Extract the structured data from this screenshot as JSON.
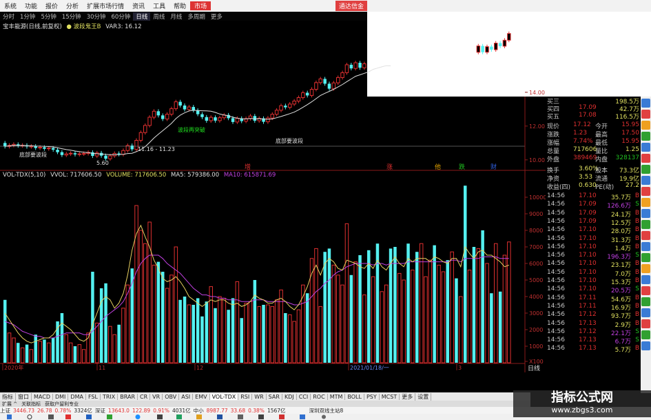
{
  "menu": {
    "items": [
      "系统",
      "功能",
      "报价",
      "分析",
      "扩展市场行情",
      "资讯",
      "工具",
      "帮助",
      "市场"
    ],
    "active_index": 8,
    "download_label": "通达信金"
  },
  "periods": [
    "分时",
    "1分钟",
    "5分钟",
    "15分钟",
    "30分钟",
    "60分钟",
    "日线",
    "周线",
    "月线",
    "多周期",
    "更多"
  ],
  "period_selected": 6,
  "title_line": {
    "stock": "宝丰能源(日线,前复权)",
    "indicator": "● 波段鬼王B",
    "var": "VAR3: 16.12"
  },
  "price_labels": {
    "low_tag": "5.60",
    "range_tag": "11.16 - 11.23",
    "buy1": "底部要波段",
    "buy2": "波段再突破",
    "buy3": "底部要波段"
  },
  "price_axis": [
    "14.00",
    "12.00",
    "10.00"
  ],
  "event_tags": [
    {
      "text": "增",
      "color": "#e03030"
    },
    {
      "text": "涨",
      "color": "#e03030"
    },
    {
      "text": "他",
      "color": "#e0a000"
    },
    {
      "text": "跌",
      "color": "#20c020"
    },
    {
      "text": "财",
      "color": "#3060e0"
    }
  ],
  "vol_line": {
    "name": "VOL-TDX(5,10)",
    "vvol": "VVOL: 717606.50",
    "volume": "VOLUME: 717606.50",
    "ma5": "MA5: 579386.00",
    "ma10": "MA10: 615871.69"
  },
  "vol_axis": [
    "10000",
    "9000",
    "8000",
    "7000",
    "6000",
    "5000",
    "4000",
    "3000",
    "2000",
    "1000",
    "X100"
  ],
  "x_labels": [
    "2020年",
    "11",
    "12",
    "2021/01/18/一",
    "3"
  ],
  "x_right_label": "日线",
  "colors": {
    "up": "#e03030",
    "down": "#54f0f0",
    "ma5": "#e8d060",
    "ma10": "#c040e0",
    "ma_price": "#e0e0e0"
  },
  "chart_data": {
    "type": "bar",
    "title": "",
    "xlabel": "",
    "ylabel": "",
    "ylim": [
      0,
      11000
    ],
    "series": [
      {
        "name": "VOLUME",
        "values": [
          3800,
          1800,
          1500,
          1200,
          900,
          1100,
          800,
          1700,
          1300,
          1400,
          1200,
          1500,
          2500,
          3000,
          1700,
          1200,
          1000,
          1100,
          800,
          1800,
          5500,
          2400,
          4500,
          4800,
          2200,
          1700,
          2300,
          3300,
          4700,
          5700,
          9500,
          8000,
          7200,
          8500,
          5900,
          6100,
          5500,
          4500,
          5300,
          7000,
          3800,
          4000,
          3500,
          3500,
          3900,
          2800,
          3700,
          4600,
          3300,
          4000,
          3900,
          3200,
          3900,
          4900,
          2700,
          3600,
          3700,
          5000,
          3400,
          3500,
          3500,
          3400,
          3800,
          4400,
          3000,
          2900,
          2500,
          3200,
          4700,
          4200,
          6300,
          6900,
          3400,
          6700,
          6900,
          5900,
          5300,
          4700,
          8400,
          5300,
          6100,
          6500,
          4100,
          6800,
          5200,
          7200,
          4300,
          4700,
          6900,
          7000,
          5400,
          5000,
          7200,
          5600,
          6700,
          7200,
          5200,
          6200,
          7100,
          5900,
          5500,
          6200,
          6700,
          5100,
          4000,
          10700,
          5600,
          7000,
          6900,
          8000,
          6000,
          4200,
          7200,
          4300,
          6500,
          7300
        ]
      }
    ],
    "up_flags": [
      0,
      1,
      1,
      0,
      1,
      0,
      1,
      0,
      1,
      0,
      1,
      0,
      0,
      0,
      1,
      1,
      0,
      1,
      1,
      1,
      0,
      1,
      0,
      0,
      1,
      1,
      0,
      1,
      1,
      0,
      1,
      1,
      1,
      1,
      1,
      0,
      0,
      1,
      1,
      1,
      0,
      0,
      1,
      0,
      0,
      0,
      0,
      1,
      0,
      1,
      1,
      0,
      0,
      1,
      0,
      1,
      1,
      0,
      1,
      0,
      1,
      1,
      1,
      1,
      0,
      1,
      1,
      1,
      1,
      0,
      1,
      1,
      1,
      0,
      0,
      1,
      1,
      1,
      1,
      0,
      1,
      0,
      1,
      0,
      1,
      0,
      1,
      1,
      0,
      0,
      1,
      1,
      0,
      1,
      0,
      1,
      1,
      1,
      0,
      1,
      1,
      0,
      1,
      0,
      1,
      0,
      1,
      0,
      1,
      0,
      1,
      0,
      1,
      0,
      1,
      1
    ],
    "ma5": [
      3000,
      2600,
      2200,
      1800,
      1500,
      1300,
      1200,
      1300,
      1400,
      1500,
      1500,
      1700,
      2100,
      2400,
      2200,
      2000,
      1700,
      1400,
      1300,
      1500,
      2300,
      3000,
      3700,
      4000,
      3800,
      3300,
      3600,
      4200,
      5300,
      6800,
      7800,
      8300,
      7600,
      7000,
      6200,
      5700,
      5100,
      4900,
      5000,
      5200,
      4900,
      4500,
      4000,
      3800,
      3600,
      3400,
      3600,
      3800,
      3700,
      3800,
      3800,
      3600,
      3500,
      3600,
      3400,
      3500,
      3700,
      4100,
      3900,
      3800,
      3600,
      3600,
      3800,
      3900,
      3700,
      3400,
      3200,
      3500,
      4000,
      4600,
      5400,
      5900,
      5300,
      6000,
      6300,
      6100,
      5700,
      5600,
      6200,
      6100,
      6000,
      5800,
      5700,
      6000,
      5700,
      6200,
      5800,
      5600,
      6000,
      6400,
      6000,
      5800,
      6300,
      6100,
      6300,
      6300,
      6300,
      6100,
      6400,
      6300,
      6100,
      6000,
      6300,
      6300,
      5800,
      7000,
      6600,
      6300,
      6700,
      6800,
      6500,
      6500,
      6300,
      6100,
      5800,
      5900
    ],
    "ma10": [
      2500,
      2400,
      2300,
      2100,
      1900,
      1800,
      1700,
      1600,
      1600,
      1500,
      1500,
      1500,
      1600,
      1700,
      1800,
      1800,
      1800,
      1800,
      1700,
      1700,
      1900,
      2200,
      2500,
      2800,
      3000,
      3200,
      3400,
      3700,
      4200,
      4800,
      5500,
      6000,
      6300,
      6500,
      6500,
      6500,
      6300,
      6000,
      5800,
      5600,
      5400,
      5100,
      4800,
      4500,
      4300,
      4100,
      4100,
      4000,
      4000,
      3900,
      3900,
      3800,
      3800,
      3800,
      3700,
      3700,
      3700,
      3800,
      3800,
      3800,
      3700,
      3700,
      3700,
      3700,
      3700,
      3600,
      3500,
      3500,
      3600,
      3700,
      4000,
      4300,
      4500,
      4800,
      5000,
      5300,
      5500,
      5600,
      5800,
      5900,
      6000,
      6000,
      6000,
      6000,
      5900,
      6000,
      6000,
      5900,
      6000,
      6000,
      6000,
      6000,
      6100,
      6100,
      6100,
      6100,
      6100,
      6100,
      6100,
      6100,
      6100,
      6100,
      6200,
      6200,
      6100,
      6300,
      6300,
      6300,
      6300,
      6400,
      6400,
      6400,
      6400,
      6300,
      6300,
      6300
    ]
  },
  "quote": {
    "top_rows": [
      {
        "label": "买三",
        "price": "",
        "vol": "198.5万"
      },
      {
        "label": "买四",
        "price": "17.09",
        "vol": "42.7万"
      },
      {
        "label": "买五",
        "price": "17.08",
        "vol": "116.5万"
      }
    ],
    "stats": [
      {
        "l1": "现价",
        "v1": "17.12",
        "l2": "今开",
        "v2": "15.95",
        "c1": "#e03030",
        "c2": "#e03030"
      },
      {
        "l1": "涨跌",
        "v1": "1.23",
        "l2": "最高",
        "v2": "17.50",
        "c1": "#e03030",
        "c2": "#e03030"
      },
      {
        "l1": "涨幅",
        "v1": "7.74%",
        "l2": "最低",
        "v2": "15.95",
        "c1": "#e03030",
        "c2": "#e03030"
      },
      {
        "l1": "总量",
        "v1": "717606",
        "l2": "量比",
        "v2": "1.25",
        "c1": "#e0e060",
        "c2": "#e0e060"
      },
      {
        "l1": "外盘",
        "v1": "389469",
        "l2": "内盘",
        "v2": "328137",
        "c1": "#e03030",
        "c2": "#20c020"
      }
    ],
    "fund_rows": [
      {
        "l1": "换手",
        "v1": "3.60%",
        "l2": "股本",
        "v2": "73.3亿"
      },
      {
        "l1": "净资",
        "v1": "3.53",
        "l2": "流通",
        "v2": "19.9亿"
      },
      {
        "l1": "收益(四)",
        "v1": "0.630",
        "l2": "PE(动)",
        "v2": "27.2"
      }
    ],
    "ticks": [
      {
        "time": "14:56",
        "price": "17.10",
        "vol": "35.7万",
        "flag": "B"
      },
      {
        "time": "14:56",
        "price": "17.09",
        "vol": "126.6万",
        "flag": "S"
      },
      {
        "time": "14:56",
        "price": "17.09",
        "vol": "24.1万",
        "flag": "B"
      },
      {
        "time": "14:56",
        "price": "17.09",
        "vol": "12.5万",
        "flag": "B"
      },
      {
        "time": "14:56",
        "price": "17.10",
        "vol": "28.0万",
        "flag": "B"
      },
      {
        "time": "14:56",
        "price": "17.10",
        "vol": "31.3万",
        "flag": "B"
      },
      {
        "time": "14:56",
        "price": "17.10",
        "vol": "1.4万",
        "flag": "B"
      },
      {
        "time": "14:56",
        "price": "17.10",
        "vol": "196.3万",
        "flag": "S"
      },
      {
        "time": "14:56",
        "price": "17.10",
        "vol": "23.1万",
        "flag": "B"
      },
      {
        "time": "14:56",
        "price": "17.10",
        "vol": "7.0万",
        "flag": "B"
      },
      {
        "time": "14:56",
        "price": "17.10",
        "vol": "15.3万",
        "flag": "B"
      },
      {
        "time": "14:56",
        "price": "17.10",
        "vol": "20.5万",
        "flag": "S"
      },
      {
        "time": "14:56",
        "price": "17.11",
        "vol": "54.6万",
        "flag": "B"
      },
      {
        "time": "14:56",
        "price": "17.11",
        "vol": "16.9万",
        "flag": "B"
      },
      {
        "time": "14:56",
        "price": "17.12",
        "vol": "93.7万",
        "flag": "B"
      },
      {
        "time": "14:56",
        "price": "17.13",
        "vol": "2.9万",
        "flag": "B"
      },
      {
        "time": "14:56",
        "price": "17.12",
        "vol": "22.1万",
        "flag": "S"
      },
      {
        "time": "14:56",
        "price": "17.13",
        "vol": "6.7万",
        "flag": "S"
      },
      {
        "time": "14:56",
        "price": "17.13",
        "vol": "5.7万",
        "flag": "B"
      }
    ]
  },
  "tabs": [
    "指标",
    "窗口",
    "MACD",
    "DMI",
    "DMA",
    "FSL",
    "TRIX",
    "BRAR",
    "CR",
    "VR",
    "OBV",
    "ASI",
    "EMV",
    "VOL-TDX",
    "RSI",
    "WR",
    "SAR",
    "KDJ",
    "CCI",
    "ROC",
    "MTM",
    "BOLL",
    "PSY",
    "MCST",
    "更多",
    "设置"
  ],
  "tab_selected": 13,
  "ext_items": [
    "扩展 ^",
    "关联指标",
    "获取户留利专业"
  ],
  "status": {
    "sh_label": "上证",
    "sh_val": "3446.73",
    "sh_chg": "26.78",
    "sh_pct": "0.78%",
    "sh_amt": "3324亿",
    "sz_label": "深证",
    "sz_val": "13643.0",
    "sz_chg": "122.89",
    "sz_pct": "0.91%",
    "sz_amt": "4031亿",
    "zx_label": "中小",
    "zx_val": "8987.77",
    "zx_chg": "33.68",
    "zx_pct": "0.38%",
    "zx_amt": "1567亿",
    "extra": "深圳双线主站8"
  },
  "watermark": {
    "line1": "指标公式网",
    "line2": "www.zbgs3.com"
  }
}
